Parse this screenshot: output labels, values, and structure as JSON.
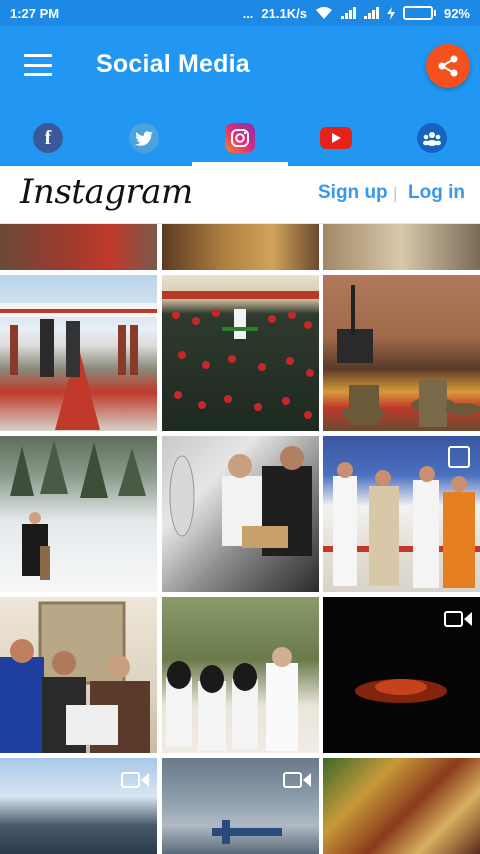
{
  "status_bar": {
    "time": "1:27 PM",
    "dots": "...",
    "speed": "21.1K/s",
    "battery": "92%",
    "battery_level": 0.92
  },
  "app_bar": {
    "title": "Social Media",
    "menu_icon": "hamburger-menu-icon",
    "share_icon": "share-icon",
    "share_color": "#f4511e",
    "background": "#2196f3"
  },
  "tabs": [
    {
      "id": "facebook",
      "icon": "facebook-icon",
      "glyph": "f"
    },
    {
      "id": "twitter",
      "icon": "twitter-icon"
    },
    {
      "id": "instagram",
      "icon": "instagram-icon",
      "active": true
    },
    {
      "id": "youtube",
      "icon": "youtube-icon"
    },
    {
      "id": "groups",
      "icon": "group-icon"
    }
  ],
  "instagram": {
    "logo": "Instagram",
    "signup": "Sign up",
    "separator": "|",
    "login": "Log in",
    "link_color": "#3897f0"
  },
  "grid": {
    "tiles": [
      {
        "kind": "photo"
      },
      {
        "kind": "photo"
      },
      {
        "kind": "photo"
      },
      {
        "kind": "photo"
      },
      {
        "kind": "photo"
      },
      {
        "kind": "photo"
      },
      {
        "kind": "photo"
      },
      {
        "kind": "photo"
      },
      {
        "kind": "album"
      },
      {
        "kind": "photo"
      },
      {
        "kind": "photo"
      },
      {
        "kind": "video"
      },
      {
        "kind": "video"
      },
      {
        "kind": "video"
      },
      {
        "kind": "photo"
      }
    ]
  }
}
